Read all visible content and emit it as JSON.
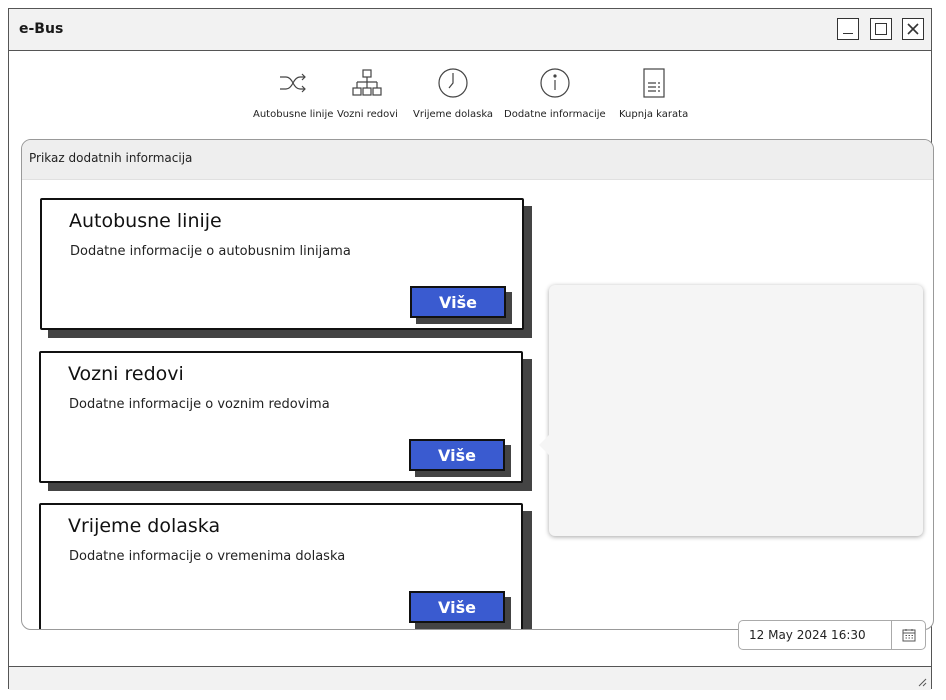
{
  "window": {
    "title": "e-Bus"
  },
  "toolbar": {
    "items": [
      {
        "label": "Autobusne linije",
        "icon": "shuffle-icon"
      },
      {
        "label": "Vozni redovi",
        "icon": "sitemap-icon"
      },
      {
        "label": "Vrijeme dolaska",
        "icon": "clock-icon"
      },
      {
        "label": "Dodatne informacije",
        "icon": "info-icon"
      },
      {
        "label": "Kupnja karata",
        "icon": "document-icon"
      }
    ]
  },
  "panel": {
    "header": "Prikaz dodatnih informacija",
    "cards": [
      {
        "title": "Autobusne linije",
        "description": "Dodatne informacije o autobusnim linijama",
        "button": "Više"
      },
      {
        "title": "Vozni redovi",
        "description": "Dodatne informacije o voznim redovima",
        "button": "Više"
      },
      {
        "title": "Vrijeme dolaska",
        "description": "Dodatne informacije o vremenima dolaska",
        "button": "Više"
      }
    ]
  },
  "datetime": {
    "value": "12 May 2024 16:30",
    "icon": "calendar-icon"
  },
  "colors": {
    "accent": "#3a5bd0",
    "shadow": "#444444"
  }
}
